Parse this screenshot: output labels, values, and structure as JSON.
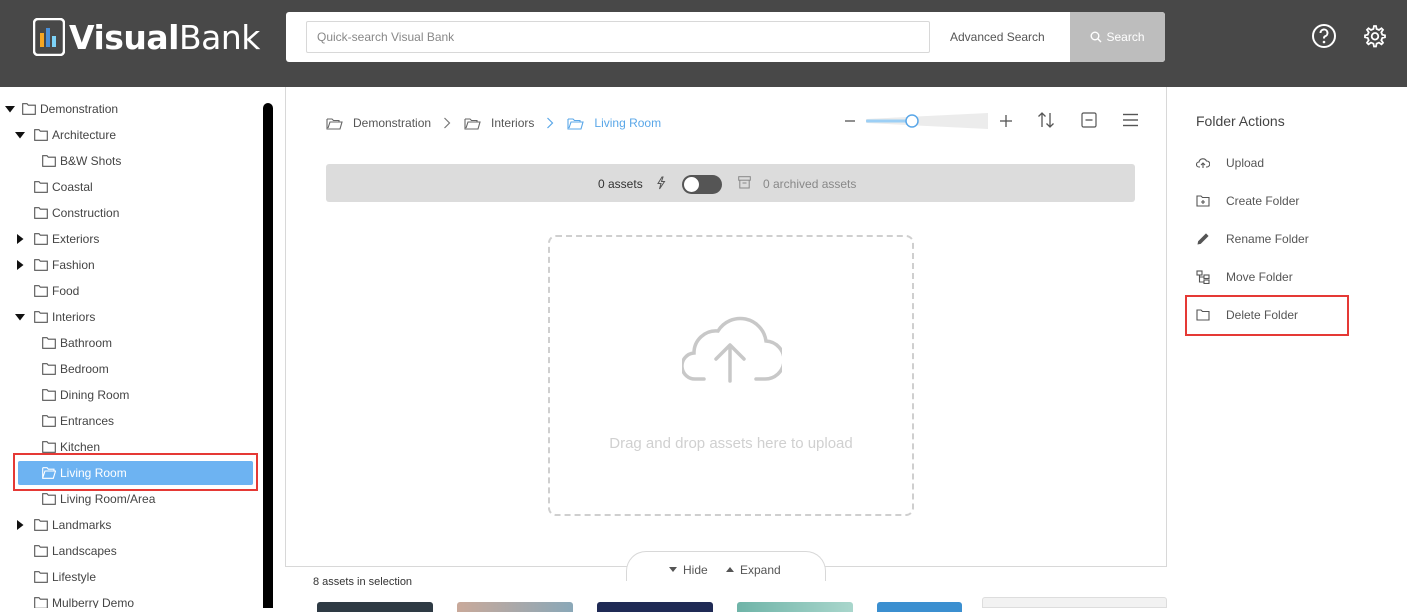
{
  "header": {
    "logo_bold": "Visual",
    "logo_regular": "Bank",
    "search_placeholder": "Quick-search Visual Bank",
    "advanced_search_label": "Advanced Search",
    "search_button_label": "Search",
    "help_icon": "help-circle-icon",
    "settings_icon": "gear-icon"
  },
  "sidebar": {
    "items": [
      {
        "label": "Demonstration",
        "expanded": true
      },
      {
        "label": "Architecture",
        "expanded": true
      },
      {
        "label": "B&W Shots"
      },
      {
        "label": "Coastal"
      },
      {
        "label": "Construction"
      },
      {
        "label": "Exteriors",
        "collapsed": true
      },
      {
        "label": "Fashion",
        "collapsed": true
      },
      {
        "label": "Food"
      },
      {
        "label": "Interiors",
        "expanded": true
      },
      {
        "label": "Bathroom"
      },
      {
        "label": "Bedroom"
      },
      {
        "label": "Dining Room"
      },
      {
        "label": "Entrances"
      },
      {
        "label": "Kitchen"
      },
      {
        "label": "Living Room",
        "selected": true
      },
      {
        "label": "Living Room/Area"
      },
      {
        "label": "Landmarks",
        "collapsed": true
      },
      {
        "label": "Landscapes"
      },
      {
        "label": "Lifestyle"
      },
      {
        "label": "Mulberry Demo"
      }
    ]
  },
  "breadcrumb": [
    {
      "label": "Demonstration"
    },
    {
      "label": "Interiors"
    },
    {
      "label": "Living Room",
      "active": true
    }
  ],
  "assets_bar": {
    "count_label": "0 assets",
    "archived_label": "0 archived assets"
  },
  "dropzone": {
    "text": "Drag and drop assets here to upload"
  },
  "bottom": {
    "hide_label": "Hide",
    "expand_label": "Expand",
    "selection_label": "8 assets in selection"
  },
  "folder_actions": {
    "title": "Folder Actions",
    "items": [
      {
        "label": "Upload",
        "icon": "cloud-upload-icon"
      },
      {
        "label": "Create Folder",
        "icon": "folder-plus-icon"
      },
      {
        "label": "Rename Folder",
        "icon": "pencil-icon"
      },
      {
        "label": "Move Folder",
        "icon": "folder-tree-icon"
      },
      {
        "label": "Delete Folder",
        "icon": "folder-delete-icon"
      }
    ]
  },
  "colors": {
    "header_bg": "#484848",
    "selected_bg": "#6db3f2",
    "accent": "#5aa7e8",
    "highlight": "#e53935"
  }
}
